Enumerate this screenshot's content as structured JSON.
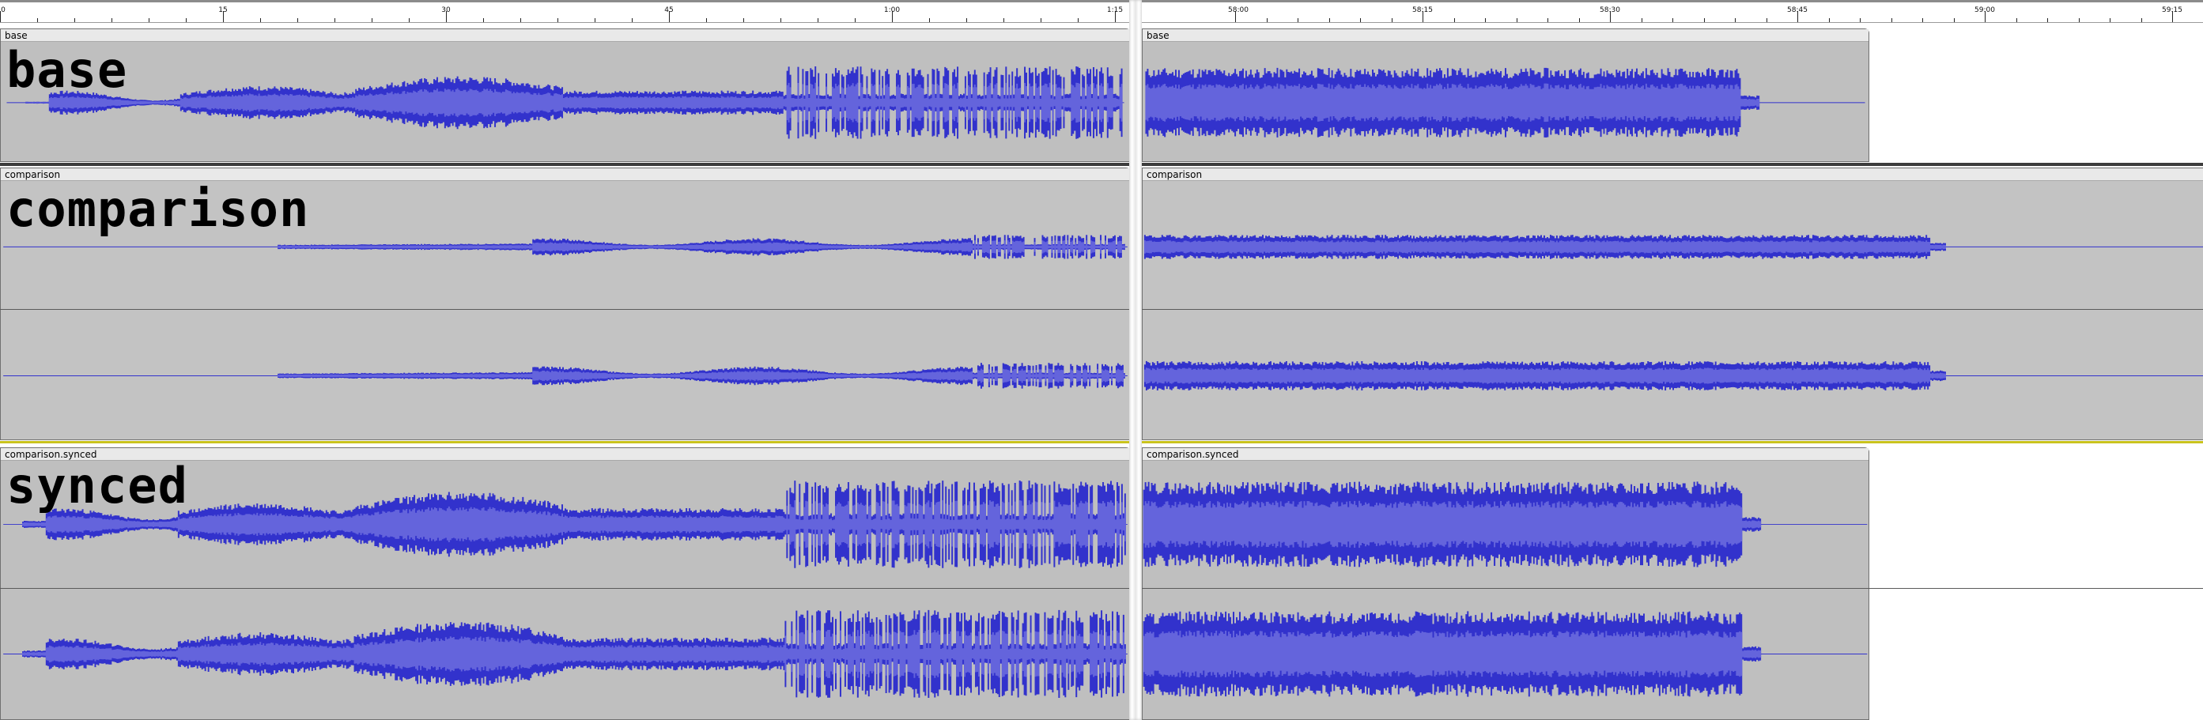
{
  "window": {
    "app_type": "audio editor – stacked comparison of two screen regions"
  },
  "ruler": {
    "left_labels": [
      "0",
      "15",
      "30",
      "45",
      "1:00",
      "1:15"
    ],
    "right_labels": [
      "58:00",
      "58:15",
      "58:30",
      "58:45",
      "59:00",
      "59:15"
    ]
  },
  "tracks": [
    {
      "id": "base",
      "clip_name": "base",
      "overlay_label": "base",
      "channels": 1
    },
    {
      "id": "comparison",
      "clip_name": "comparison",
      "overlay_label": "comparison",
      "channels": 2
    },
    {
      "id": "synced",
      "clip_name": "comparison.synced",
      "overlay_label": "synced",
      "channels": 2
    }
  ],
  "colors": {
    "wave_peak": "#3232cc",
    "wave_rms": "#6464dc",
    "track_bg": "#c3c3c3",
    "clip_title_bg": "#e9e9e9",
    "baseline": "#3232cc",
    "selected_track_border": "#c9c31d"
  }
}
